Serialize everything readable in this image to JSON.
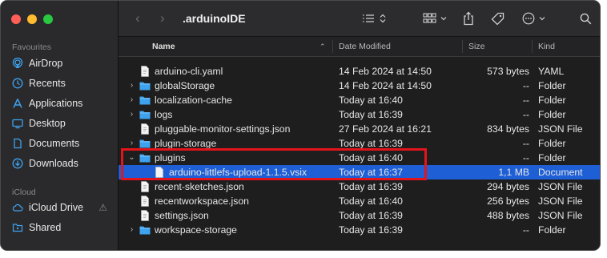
{
  "window": {
    "title": ".arduinoIDE"
  },
  "sidebar": {
    "favourites_label": "Favourites",
    "icloud_label": "iCloud",
    "favourites": [
      {
        "label": "AirDrop",
        "icon": "airdrop-icon"
      },
      {
        "label": "Recents",
        "icon": "clock-icon"
      },
      {
        "label": "Applications",
        "icon": "applications-icon"
      },
      {
        "label": "Desktop",
        "icon": "desktop-icon"
      },
      {
        "label": "Documents",
        "icon": "document-icon"
      },
      {
        "label": "Downloads",
        "icon": "download-icon"
      }
    ],
    "icloud": [
      {
        "label": "iCloud Drive",
        "icon": "cloud-icon",
        "badge": "⚠"
      },
      {
        "label": "Shared",
        "icon": "shared-folder-icon"
      }
    ]
  },
  "columns": {
    "name": "Name",
    "date": "Date Modified",
    "size": "Size",
    "kind": "Kind"
  },
  "files": [
    {
      "name": "arduino-cli.yaml",
      "date": "14 Feb 2024 at 14:50",
      "size": "573 bytes",
      "kind": "YAML",
      "type": "file",
      "expandable": false,
      "indent": 0
    },
    {
      "name": "globalStorage",
      "date": "14 Feb 2024 at 14:50",
      "size": "--",
      "kind": "Folder",
      "type": "folder",
      "expandable": true,
      "indent": 0
    },
    {
      "name": "localization-cache",
      "date": "Today at 16:40",
      "size": "--",
      "kind": "Folder",
      "type": "folder",
      "expandable": true,
      "indent": 0
    },
    {
      "name": "logs",
      "date": "Today at 16:39",
      "size": "--",
      "kind": "Folder",
      "type": "folder",
      "expandable": true,
      "indent": 0
    },
    {
      "name": "pluggable-monitor-settings.json",
      "date": "27 Feb 2024 at 16:21",
      "size": "834 bytes",
      "kind": "JSON File",
      "type": "file",
      "expandable": false,
      "indent": 0
    },
    {
      "name": "plugin-storage",
      "date": "Today at 16:39",
      "size": "--",
      "kind": "Folder",
      "type": "folder",
      "expandable": true,
      "indent": 0
    },
    {
      "name": "plugins",
      "date": "Today at 16:40",
      "size": "--",
      "kind": "Folder",
      "type": "folder",
      "expandable": true,
      "expanded": true,
      "indent": 0
    },
    {
      "name": "arduino-littlefs-upload-1.1.5.vsix",
      "date": "Today at 16:37",
      "size": "1,1 MB",
      "kind": "Document",
      "type": "file",
      "expandable": false,
      "indent": 1,
      "selected": true
    },
    {
      "name": "recent-sketches.json",
      "date": "Today at 16:39",
      "size": "294 bytes",
      "kind": "JSON File",
      "type": "file",
      "expandable": false,
      "indent": 0
    },
    {
      "name": "recentworkspace.json",
      "date": "Today at 16:40",
      "size": "256 bytes",
      "kind": "JSON File",
      "type": "file",
      "expandable": false,
      "indent": 0
    },
    {
      "name": "settings.json",
      "date": "Today at 16:39",
      "size": "488 bytes",
      "kind": "JSON File",
      "type": "file",
      "expandable": false,
      "indent": 0
    },
    {
      "name": "workspace-storage",
      "date": "Today at 16:39",
      "size": "--",
      "kind": "Folder",
      "type": "folder",
      "expandable": true,
      "indent": 0
    }
  ],
  "colors": {
    "selection": "#1e5fd6",
    "folder": "#3ea2ee",
    "highlight_box": "#e3141b"
  }
}
